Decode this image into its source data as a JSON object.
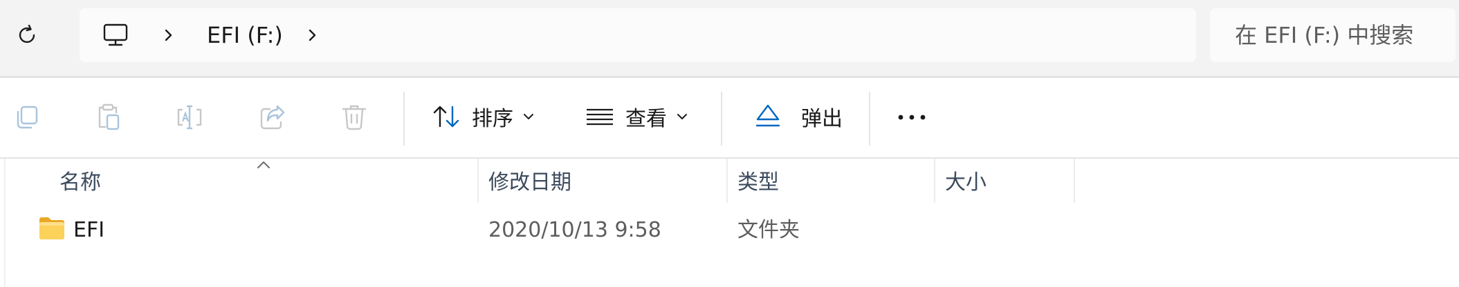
{
  "address_bar": {
    "refresh_icon": "refresh-icon",
    "breadcrumb": [
      {
        "icon": "computer-icon"
      },
      {
        "label": "EFI (F:)"
      }
    ],
    "search_placeholder": "在 EFI (F:) 中搜索"
  },
  "command_bar": {
    "icons": [
      "copy-icon",
      "paste-icon",
      "rename-icon",
      "share-icon",
      "delete-icon"
    ],
    "sort_label": "排序",
    "view_label": "查看",
    "eject_label": "弹出",
    "more_icon": "more-icon",
    "accent_color": "#0067c0"
  },
  "file_list": {
    "columns": [
      "名称",
      "修改日期",
      "类型",
      "大小"
    ],
    "sorted_column": "名称",
    "rows": [
      {
        "name": "EFI",
        "modified": "2020/10/13 9:58",
        "type": "文件夹",
        "size": "",
        "icon": "folder-icon"
      }
    ]
  }
}
